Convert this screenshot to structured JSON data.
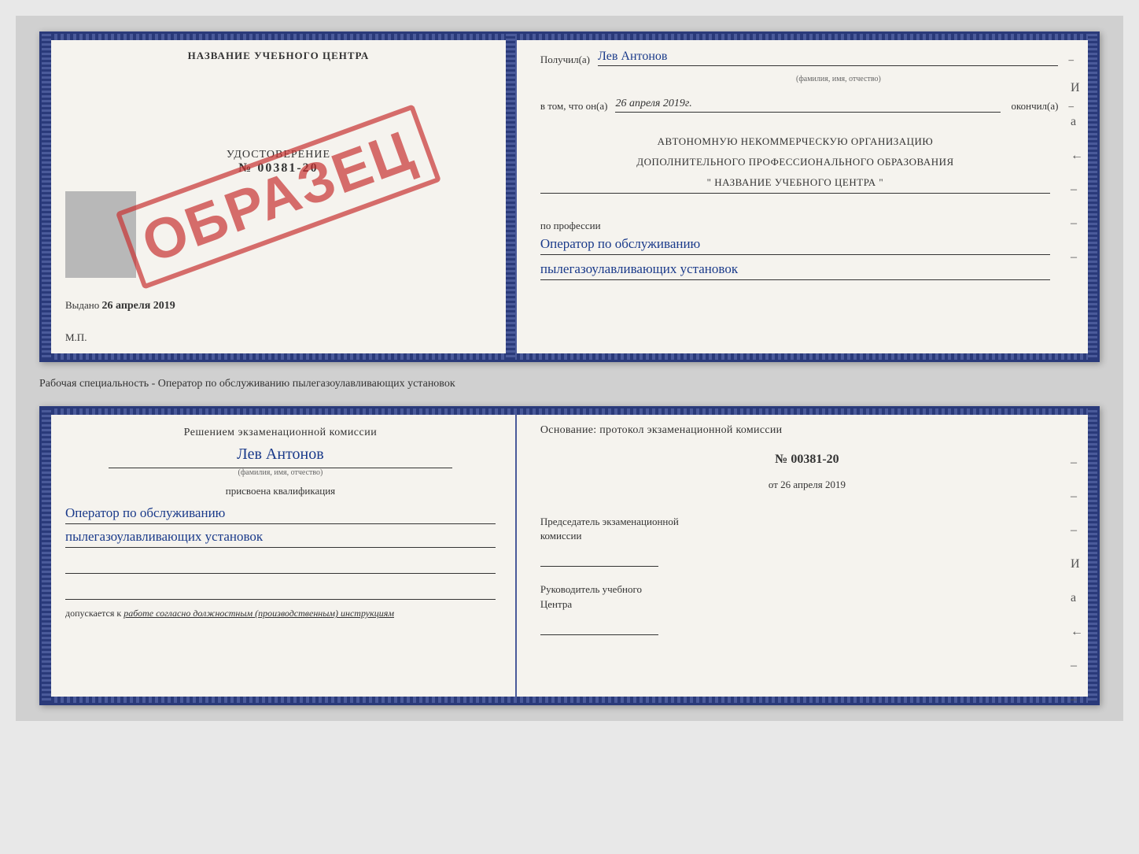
{
  "page": {
    "background_color": "#d0d0d0"
  },
  "top_doc": {
    "left": {
      "title": "НАЗВАНИЕ УЧЕБНОГО ЦЕНТРА",
      "stamp": "ОБРАЗЕЦ",
      "cert_label": "УДОСТОВЕРЕНИЕ",
      "cert_number": "№ 00381-20",
      "issued_label": "Выдано",
      "issued_date": "26 апреля 2019",
      "mp_label": "М.П."
    },
    "right": {
      "received_label": "Получил(а)",
      "received_name": "Лев Антонов",
      "received_hint": "(фамилия, имя, отчество)",
      "dash1": "–",
      "in_that_label": "в том, что он(а)",
      "completed_date": "26 апреля 2019г.",
      "completed_label": "окончил(а)",
      "dash2": "–",
      "org_line1": "АВТОНОМНУЮ НЕКОММЕРЧЕСКУЮ ОРГАНИЗАЦИЮ",
      "org_line2": "ДОПОЛНИТЕЛЬНОГО ПРОФЕССИОНАЛЬНОГО ОБРАЗОВАНИЯ",
      "org_line3": "\" НАЗВАНИЕ УЧЕБНОГО ЦЕНТРА \"",
      "dash3": "–",
      "right_label_И": "И",
      "right_label_а": "а",
      "right_label_left": "←",
      "profession_label": "по профессии",
      "profession_line1": "Оператор по обслуживанию",
      "profession_line2": "пылегазоулавливающих установок",
      "dash4": "–",
      "dash5": "–",
      "dash6": "–"
    }
  },
  "between_label": "Рабочая специальность - Оператор по обслуживанию пылегазоулавливающих установок",
  "bottom_doc": {
    "left": {
      "decision_text": "Решением экзаменационной комиссии",
      "person_name": "Лев Антонов",
      "name_hint": "(фамилия, имя, отчество)",
      "assigned_label": "присвоена квалификация",
      "qualification_line1": "Оператор по обслуживанию",
      "qualification_line2": "пылегазоулавливающих установок",
      "blank_line1": "",
      "blank_line2": "",
      "допускается_label": "допускается к",
      "допускается_value": "работе согласно должностным (производственным) инструкциям"
    },
    "right": {
      "basis_label": "Основание: протокол экзаменационной комиссии",
      "protocol_number": "№ 00381-20",
      "protocol_date_prefix": "от",
      "protocol_date": "26 апреля 2019",
      "dash1": "–",
      "dash2": "–",
      "dash3": "–",
      "right_label_И": "И",
      "right_label_а": "а",
      "right_label_left": "←",
      "chairman_label1": "Председатель экзаменационной",
      "chairman_label2": "комиссии",
      "chairman_sig_line": "",
      "head_label1": "Руководитель учебного",
      "head_label2": "Центра",
      "head_sig_line": "",
      "dash4": "–",
      "dash5": "–"
    }
  }
}
